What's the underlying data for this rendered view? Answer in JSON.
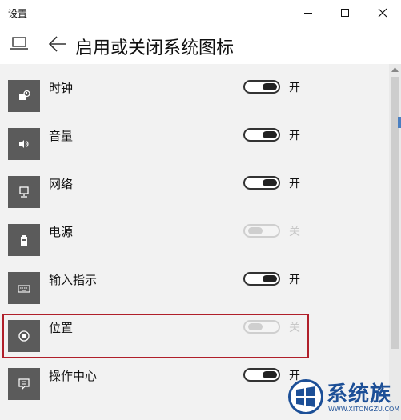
{
  "window": {
    "title": "设置"
  },
  "header": {
    "title": "启用或关闭系统图标"
  },
  "items": [
    {
      "label": "时钟",
      "state": "开",
      "enabled": true,
      "icon": "clock-icon"
    },
    {
      "label": "音量",
      "state": "开",
      "enabled": true,
      "icon": "volume-icon"
    },
    {
      "label": "网络",
      "state": "开",
      "enabled": true,
      "icon": "network-icon"
    },
    {
      "label": "电源",
      "state": "关",
      "enabled": false,
      "icon": "power-icon"
    },
    {
      "label": "输入指示",
      "state": "开",
      "enabled": true,
      "icon": "keyboard-icon"
    },
    {
      "label": "位置",
      "state": "关",
      "enabled": false,
      "icon": "location-icon"
    },
    {
      "label": "操作中心",
      "state": "开",
      "enabled": true,
      "icon": "action-center-icon"
    }
  ],
  "watermark": {
    "text": "系统族",
    "url": "WWW.XITONGZU.COM"
  },
  "colors": {
    "tile": "#5b5b5b",
    "highlight": "#b01f2a",
    "brand": "#1c4f97"
  }
}
